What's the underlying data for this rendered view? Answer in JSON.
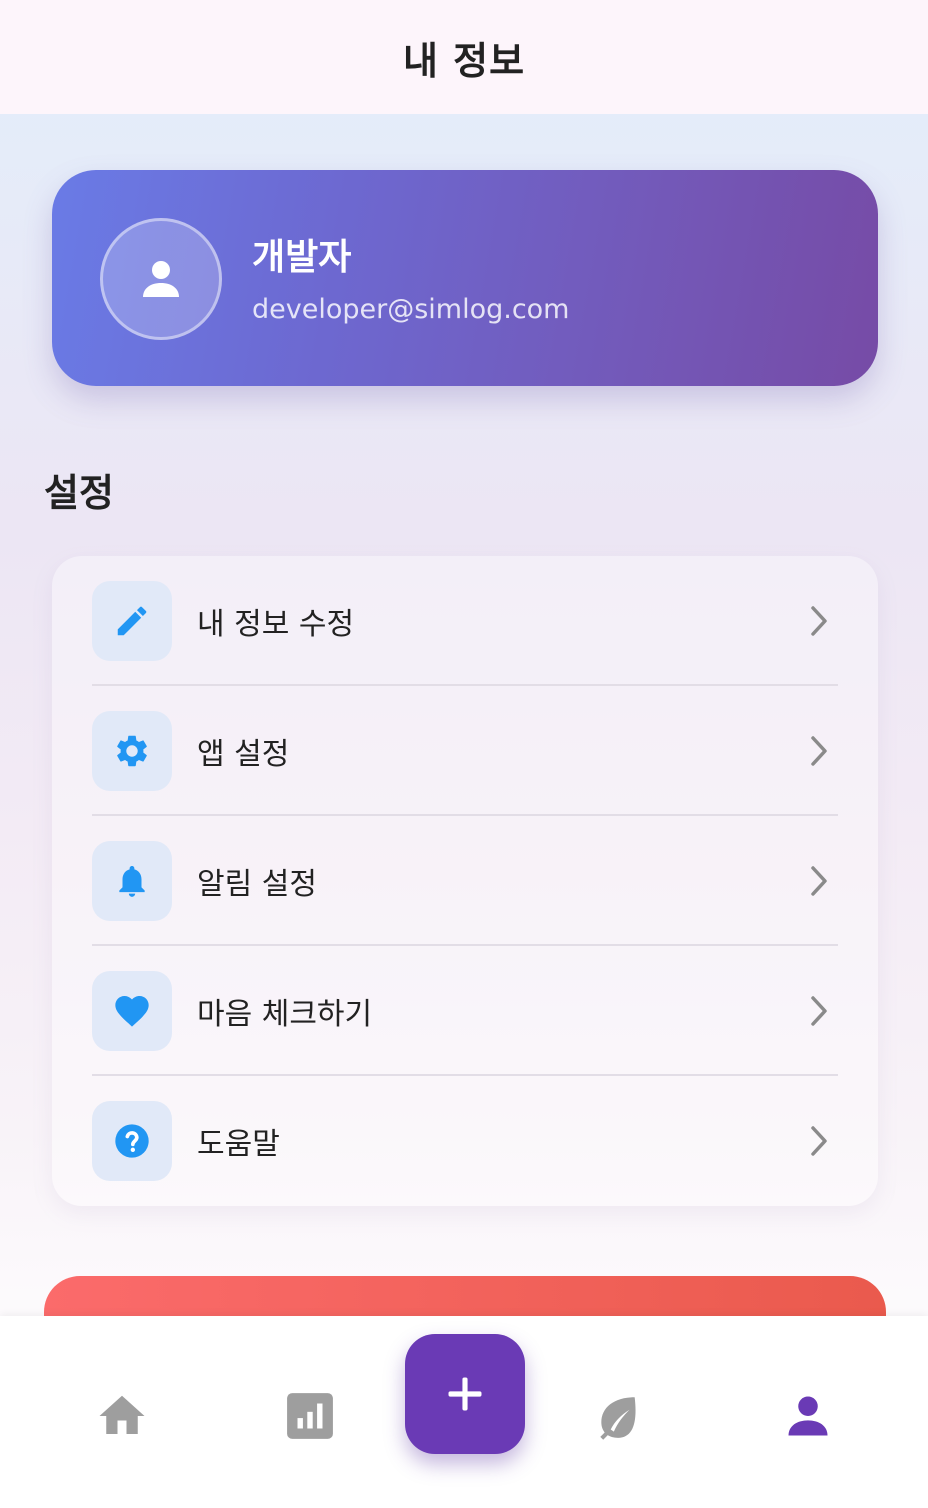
{
  "header": {
    "title": "내 정보"
  },
  "profile": {
    "name": "개발자",
    "email": "developer@simlog.com"
  },
  "settings": {
    "title": "설정",
    "items": [
      {
        "label": "내 정보 수정",
        "icon": "pencil-icon"
      },
      {
        "label": "앱 설정",
        "icon": "gear-icon"
      },
      {
        "label": "알림 설정",
        "icon": "bell-icon"
      },
      {
        "label": "마음 체크하기",
        "icon": "heart-icon"
      },
      {
        "label": "도움말",
        "icon": "help-icon"
      }
    ]
  },
  "bottom_nav": {
    "items": [
      {
        "name": "home",
        "icon": "home-icon",
        "active": false
      },
      {
        "name": "stats",
        "icon": "chart-icon",
        "active": false
      },
      {
        "name": "add",
        "icon": "plus-icon",
        "active": false
      },
      {
        "name": "leaf",
        "icon": "leaf-icon",
        "active": false
      },
      {
        "name": "profile",
        "icon": "person-icon",
        "active": true
      }
    ]
  },
  "colors": {
    "accent": "#6a3ab5",
    "icon_blue": "#2196f3",
    "inactive_nav": "#9e9e9e",
    "logout": "#f0625a"
  }
}
